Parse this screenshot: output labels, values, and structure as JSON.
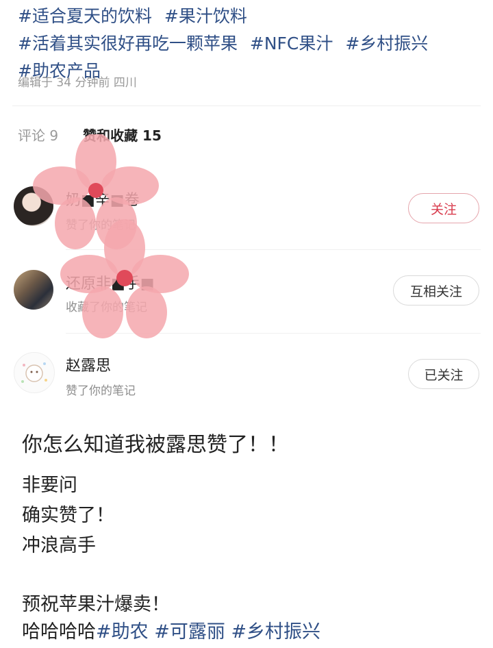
{
  "note": {
    "hashtags": [
      "#适合夏天的饮料",
      "#果汁饮料",
      "#活着其实很好再吃一颗苹果",
      "#NFC果汁",
      "#乡村振兴",
      "#助农产品"
    ],
    "edited": "编辑于 34 分钟前 四川"
  },
  "tabs": {
    "comments": "评论 9",
    "likes_and_favorites": "赞和收藏 15"
  },
  "users": [
    {
      "name": "奶■辛■卷",
      "action": "赞了你的笔记",
      "button": "关注"
    },
    {
      "name": "还原非■手■",
      "action": "收藏了你的笔记",
      "button": "互相关注"
    },
    {
      "name": "赵露思",
      "action": "赞了你的笔记",
      "button": "已关注"
    }
  ],
  "post": {
    "title": "你怎么知道我被露思赞了！！",
    "lines": [
      "非要问",
      "确实赞了！",
      "冲浪高手"
    ],
    "closing": "预祝苹果汁爆卖！",
    "tag_prefix": "哈哈哈哈",
    "tags": [
      "#助农",
      "#可露丽",
      "#乡村振兴"
    ]
  },
  "colors": {
    "hashtag": "#2f4f86",
    "follow_accent": "#d83a4c",
    "sticker_pink": "#f5a7ad"
  }
}
